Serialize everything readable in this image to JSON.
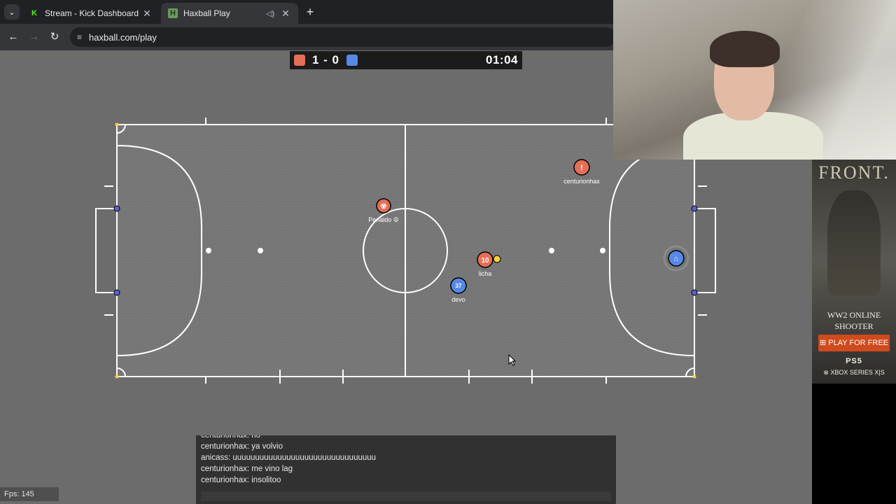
{
  "browser": {
    "tabs": [
      {
        "title": "Stream - Kick Dashboard",
        "favicon": "kick-icon",
        "active": false
      },
      {
        "title": "Haxball Play",
        "favicon": "haxball-icon",
        "active": true
      }
    ],
    "url": "haxball.com/play"
  },
  "scoreboard": {
    "score": "1 - 0",
    "time": "01:04",
    "red_color": "#e56e56",
    "blue_color": "#5689e5"
  },
  "players": [
    {
      "name": "Penaldo ☮",
      "team": "red",
      "avatar": "☢"
    },
    {
      "name": "centurionhax",
      "team": "red",
      "avatar": "!"
    },
    {
      "name": "licha",
      "team": "red",
      "avatar": "10"
    },
    {
      "name": "devo",
      "team": "blue",
      "avatar": "37"
    },
    {
      "name": "",
      "team": "blue",
      "avatar": "⌂"
    }
  ],
  "chat": {
    "messages": [
      "centurionhax: no",
      "centurionhax: ya volvio",
      "anicass: uuuuuuuuuuuuuuuuuuuuuuuuuuuuuuuu",
      "centurionhax: me vino lag",
      "centurionhax: insolitoo"
    ]
  },
  "fps": "Fps: 145",
  "ad": {
    "brand": "FRONT.",
    "tagline_1": "WW2 ONLINE",
    "tagline_2": "SHOOTER",
    "cta": "PLAY FOR FREE",
    "platform_1": "PS5",
    "platform_2": "XBOX SERIES X|S"
  }
}
